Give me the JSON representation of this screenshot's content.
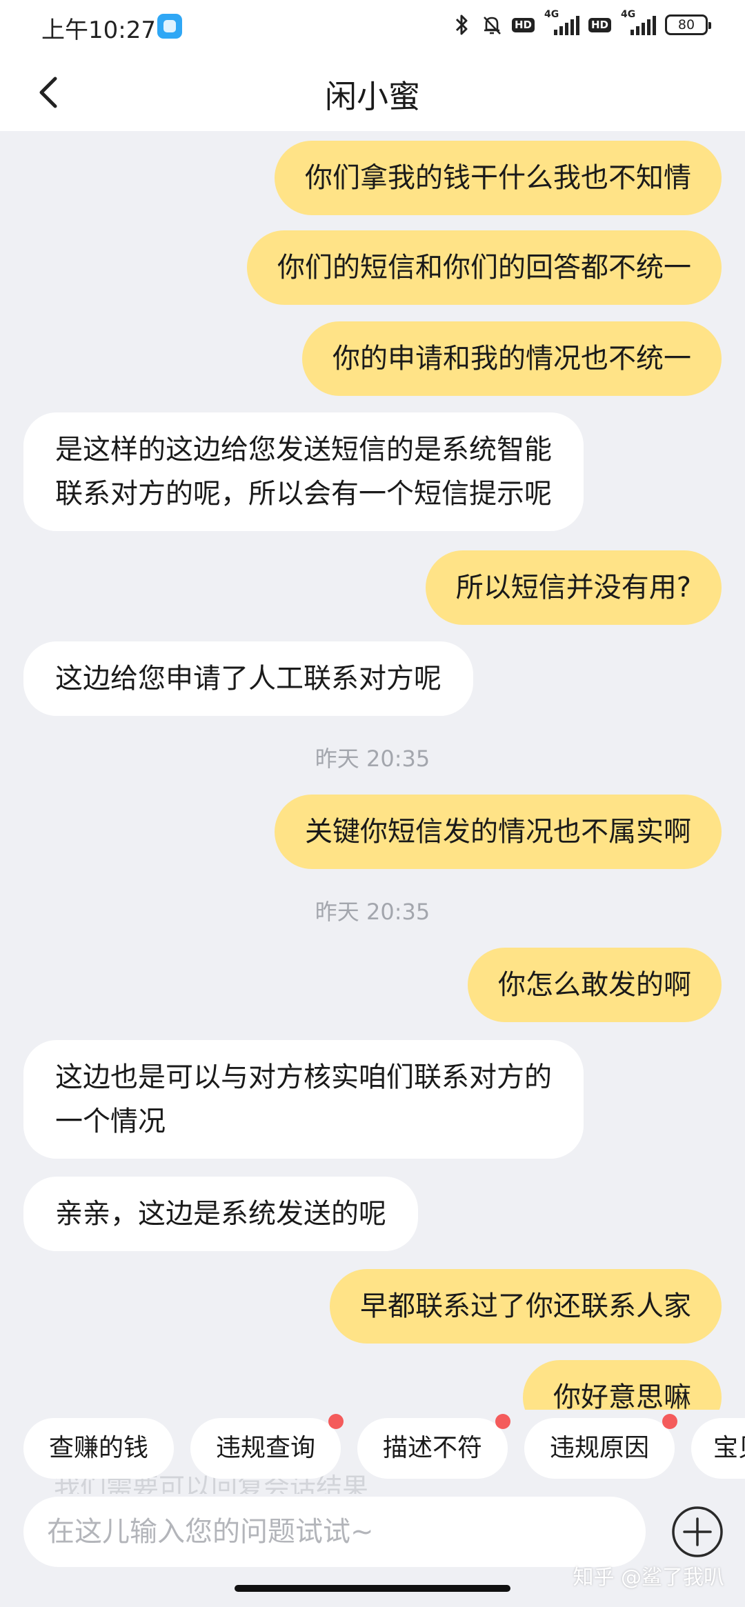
{
  "status_bar": {
    "time": "上午10:27",
    "hd1": "HD",
    "hd2": "HD",
    "net1": "4G",
    "net2": "4G",
    "battery": "80"
  },
  "header": {
    "title": "闲小蜜",
    "back_icon": "chevron-left-icon"
  },
  "messages": [
    {
      "from": "me",
      "text": "你们拿我的钱干什么我也不知情"
    },
    {
      "from": "me",
      "text": "你们的短信和你们的回答都不统一"
    },
    {
      "from": "me",
      "text": "你的申请和我的情况也不统一"
    },
    {
      "from": "them",
      "line1": "是这样的这边给您发送短信的是系统智能",
      "line2": "联系对方的呢，所以会有一个短信提示呢"
    },
    {
      "from": "me",
      "text": "所以短信并没有用?"
    },
    {
      "from": "them",
      "text": "这边给您申请了人工联系对方呢"
    },
    {
      "from": "time",
      "text": "昨天 20:35"
    },
    {
      "from": "me",
      "text": "关键你短信发的情况也不属实啊"
    },
    {
      "from": "time",
      "text": "昨天 20:35"
    },
    {
      "from": "me",
      "text": "你怎么敢发的啊"
    },
    {
      "from": "them",
      "line1": "这边也是可以与对方核实咱们联系对方的",
      "line2": "一个情况"
    },
    {
      "from": "them",
      "text": "亲亲，这边是系统发送的呢"
    },
    {
      "from": "me",
      "text": "早都联系过了你还联系人家"
    },
    {
      "from": "me",
      "text": "你好意思嘛"
    }
  ],
  "quick_replies": [
    {
      "label": "查赚的钱",
      "badge": false
    },
    {
      "label": "违规查询",
      "badge": true
    },
    {
      "label": "描述不符",
      "badge": true
    },
    {
      "label": "违规原因",
      "badge": true
    },
    {
      "label": "宝贝",
      "badge": false
    }
  ],
  "faded_text": "我们需要可以回复会话结果",
  "input": {
    "placeholder": "在这儿输入您的问题试试~",
    "value": ""
  },
  "plus_icon": "plus-circle-icon",
  "watermark": "知乎 @鲨了我叭",
  "colors": {
    "my_bubble": "#FFE387",
    "their_bubble": "#FFFFFF",
    "background": "#EFF0F4",
    "badge_dot": "#F45B5B"
  }
}
